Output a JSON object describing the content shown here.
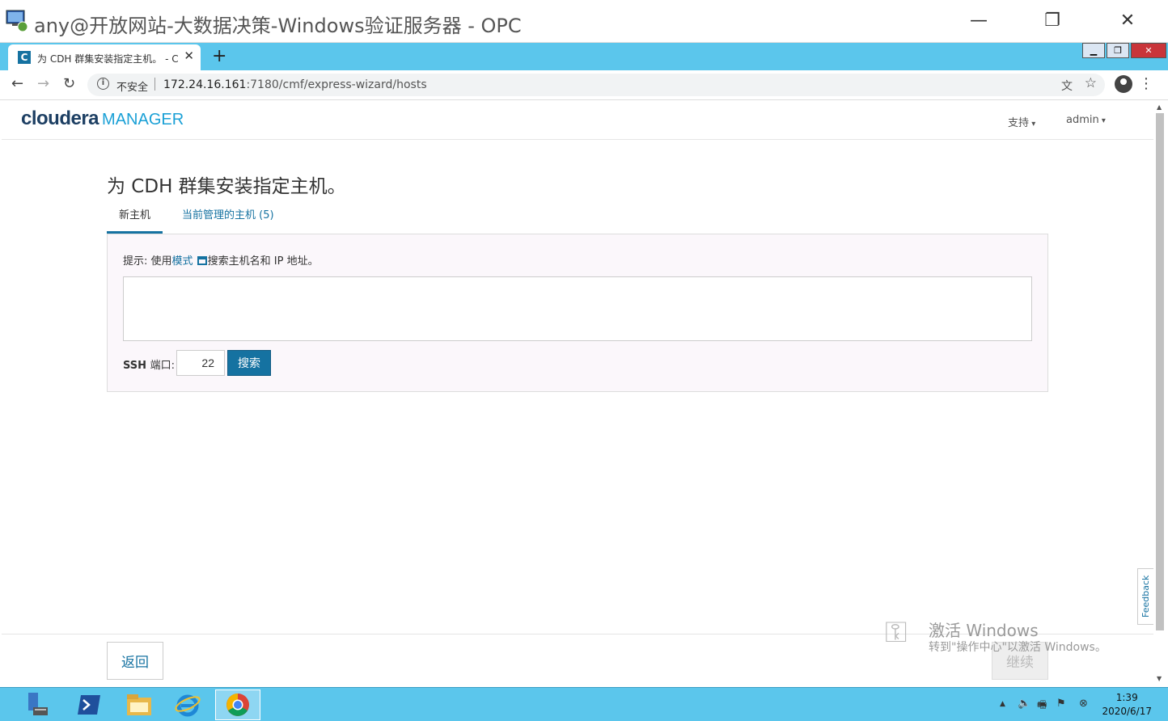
{
  "window": {
    "title": "any@开放网站-大数据决策-Windows验证服务器 - OPC",
    "minimize": "—",
    "maximize": "❐",
    "close": "✕"
  },
  "browser": {
    "tab_title": "为 CDH 群集安装指定主机。 - C",
    "favicon_letter": "C",
    "tab_close": "✕",
    "new_tab": "+",
    "inner_controls": [
      "▁",
      "❐",
      "✕"
    ],
    "insecure_label": "不安全",
    "url_host": "172.24.16.161",
    "url_path": ":7180/cmf/express-wizard/hosts"
  },
  "header": {
    "logo_main": "cloudera",
    "logo_sub": "MANAGER",
    "support": "支持",
    "user": "admin"
  },
  "main": {
    "title": "为 CDH 群集安装指定主机。",
    "tabs": [
      {
        "label": "新主机",
        "active": true
      },
      {
        "label": "当前管理的主机 (5)",
        "active": false
      }
    ],
    "hint_prefix": "提示: 使用",
    "hint_link": "模式",
    "hint_suffix": "搜索主机名和 IP 地址。",
    "hosts_value": "",
    "ssh_label": "SSH",
    "ssh_label_cn": "端口:",
    "ssh_port": "22",
    "search_button": "搜索"
  },
  "footer": {
    "back": "返回",
    "continue": "继续"
  },
  "feedback": "Feedback",
  "watermark": {
    "line1": "激活 Windows",
    "line2": "转到\"操作中心\"以激活 Windows。"
  },
  "taskbar": {
    "time": "1:39",
    "date": "2020/6/17"
  },
  "colors": {
    "accent": "#1572a1",
    "browser_chrome": "#5bc6ec"
  }
}
